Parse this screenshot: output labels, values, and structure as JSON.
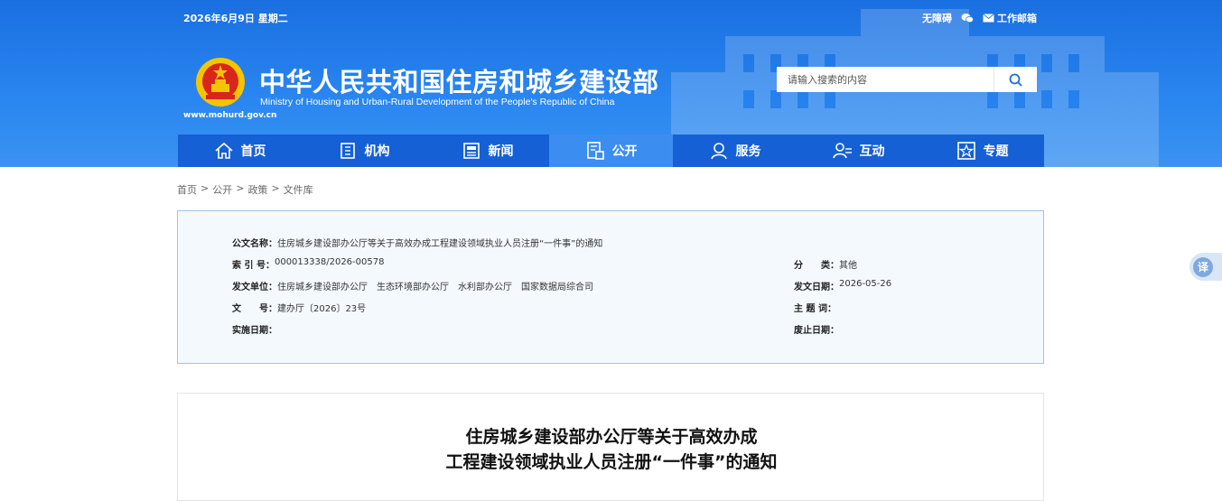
{
  "topbar": {
    "date": "2026年6月9日 星期二",
    "accessibility": "无障碍",
    "mail": "工作邮箱"
  },
  "site": {
    "title_cn": "中华人民共和国住房和城乡建设部",
    "title_en": "Ministry of Housing and Urban-Rural Development of the People's Republic of China",
    "url": "www.mohurd.gov.cn"
  },
  "search": {
    "placeholder": "请输入搜索的内容"
  },
  "nav": {
    "items": [
      {
        "label": "首页",
        "icon": "home-icon"
      },
      {
        "label": "机构",
        "icon": "building-icon"
      },
      {
        "label": "新闻",
        "icon": "news-icon"
      },
      {
        "label": "公开",
        "icon": "document-icon"
      },
      {
        "label": "服务",
        "icon": "service-icon"
      },
      {
        "label": "互动",
        "icon": "interact-icon"
      },
      {
        "label": "专题",
        "icon": "star-icon"
      }
    ],
    "active": "公开"
  },
  "breadcrumb": [
    "首页",
    "公开",
    "政策",
    "文件库"
  ],
  "breadcrumb_sep": ">",
  "meta": {
    "title_label": "公文名称：",
    "title_value": "住房城乡建设部办公厅等关于高效办成工程建设领域执业人员注册“一件事”的通知",
    "index_label": "索 引 号：",
    "index_value": "000013338/2026-00578",
    "category_label": "分　　类：",
    "category_value": "其他",
    "issuer_label": "发文单位：",
    "issuer_value": "住房城乡建设部办公厅　生态环境部办公厅　水利部办公厅　国家数据局综合司",
    "date_label": "发文日期：",
    "date_value": "2026-05-26",
    "docno_label": "文　　号：",
    "docno_value": "建办厅〔2026〕23号",
    "topic_label": "主 题 词：",
    "topic_value": "",
    "effective_label": "实施日期：",
    "effective_value": "",
    "expire_label": "废止日期：",
    "expire_value": ""
  },
  "article": {
    "title_line1": "住房城乡建设部办公厅等关于高效办成",
    "title_line2": "工程建设领域执业人员注册“一件事”的通知"
  },
  "translate": {
    "label": "译"
  },
  "colors": {
    "header": "#1a6fe0",
    "nav": "#1560d4",
    "nav_active": "#3b8ef0",
    "meta_border": "#9cc4ea"
  }
}
